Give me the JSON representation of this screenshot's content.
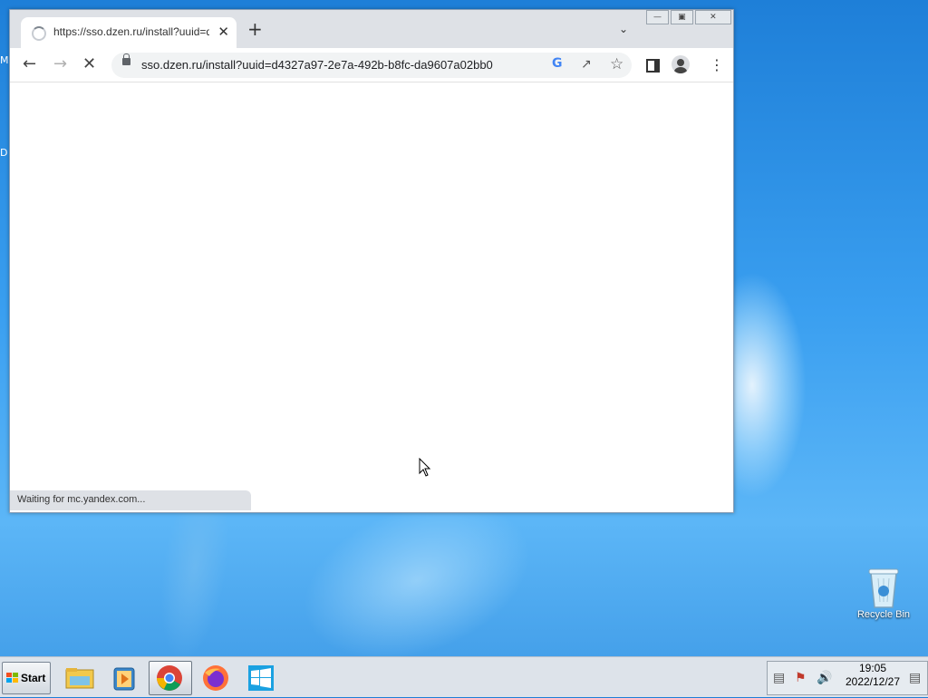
{
  "browser": {
    "tab_title": "https://sso.dzen.ru/install?uuid=d",
    "tab_close": "✕",
    "new_tab": "+",
    "url": "sso.dzen.ru/install?uuid=d4327a97-2e7a-492b-b8fc-da9607a02bb0",
    "status": "Waiting for mc.yandex.com..."
  },
  "desktop": {
    "edge_letters": [
      "M",
      "D"
    ],
    "recycle_bin_label": "Recycle Bin"
  },
  "taskbar": {
    "start_label": "Start",
    "clock_time": "19:05",
    "clock_date": "2022/12/27"
  },
  "colors": {
    "desktop_blue": "#3a9ff0",
    "tabstrip_gray": "#dee1e6",
    "omnibox_gray": "#f1f3f4"
  }
}
